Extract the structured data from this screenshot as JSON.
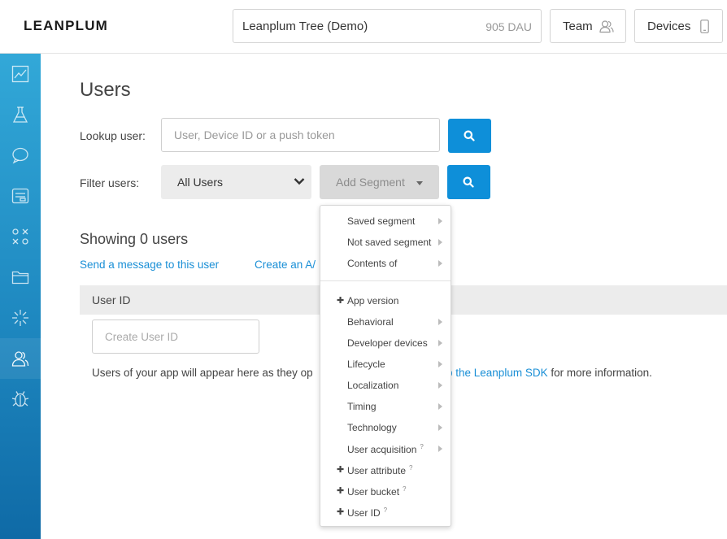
{
  "header": {
    "logo": "LEANPLUM",
    "app_name": "Leanplum Tree (Demo)",
    "dau": "905 DAU",
    "team_label": "Team",
    "devices_label": "Devices"
  },
  "sidebar": {
    "items": [
      {
        "icon": "chart-icon"
      },
      {
        "icon": "flask-icon"
      },
      {
        "icon": "chat-bubble-icon"
      },
      {
        "icon": "message-card-icon"
      },
      {
        "icon": "ab-test-icon"
      },
      {
        "icon": "folder-icon"
      },
      {
        "icon": "sparkle-icon"
      },
      {
        "icon": "users-icon",
        "active": true
      },
      {
        "icon": "bug-icon"
      }
    ]
  },
  "main": {
    "title": "Users",
    "lookup_label": "Lookup user:",
    "lookup_placeholder": "User, Device ID or a push token",
    "filter_label": "Filter users:",
    "filter_value": "All Users",
    "add_segment_label": "Add Segment",
    "showing": "Showing 0 users",
    "link_send": "Send a message to this user",
    "link_create": "Create an A/",
    "table_column": "User ID",
    "create_placeholder": "Create User ID",
    "info_left": "Users of your app will appear here as they op",
    "info_link": "p the Leanplum SDK",
    "info_right": " for more information."
  },
  "dropdown": {
    "group1": [
      {
        "label": "Saved segment",
        "submenu": true
      },
      {
        "label": "Not saved segment",
        "submenu": true
      },
      {
        "label": "Contents of",
        "submenu": true
      }
    ],
    "group2": [
      {
        "label": "App version",
        "plus": true
      },
      {
        "label": "Behavioral",
        "submenu": true
      },
      {
        "label": "Developer devices",
        "submenu": true
      },
      {
        "label": "Lifecycle",
        "submenu": true
      },
      {
        "label": "Localization",
        "submenu": true
      },
      {
        "label": "Timing",
        "submenu": true
      },
      {
        "label": "Technology",
        "submenu": true
      },
      {
        "label": "User acquisition",
        "submenu": true,
        "help": "?"
      },
      {
        "label": "User attribute",
        "plus": true,
        "help": "?"
      },
      {
        "label": "User bucket",
        "plus": true,
        "help": "?"
      },
      {
        "label": "User ID",
        "plus": true,
        "help": "?"
      }
    ],
    "plus_glyph": "✚"
  },
  "colors": {
    "accent": "#0e8fd9",
    "link": "#1a8fd6",
    "sidebar_top": "#32a8d8",
    "sidebar_bottom": "#0f6aa6"
  }
}
